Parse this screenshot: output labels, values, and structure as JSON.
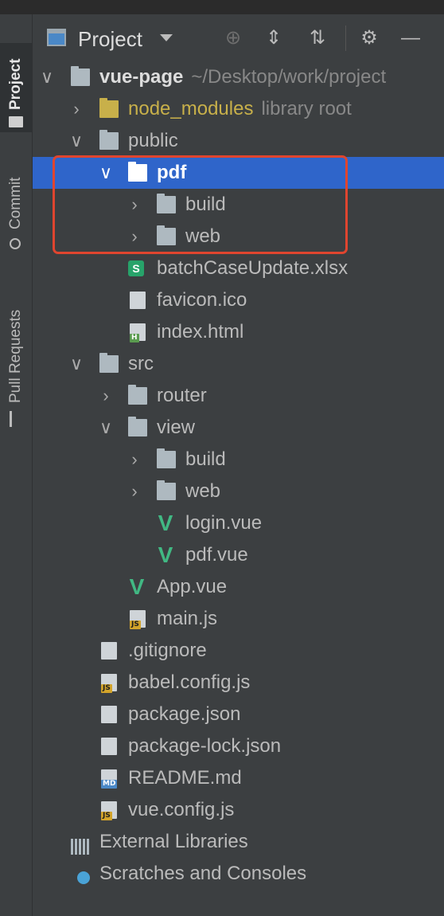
{
  "sidebar": {
    "tabs": [
      {
        "label": "Project"
      },
      {
        "label": "Commit"
      },
      {
        "label": "Pull Requests"
      }
    ]
  },
  "toolbar": {
    "title": "Project"
  },
  "tree": {
    "rows": [
      {
        "label": "vue-page",
        "hint": "~/Desktop/work/project"
      },
      {
        "label": "node_modules",
        "hint": "library root"
      },
      {
        "label": "public"
      },
      {
        "label": "pdf"
      },
      {
        "label": "build"
      },
      {
        "label": "web"
      },
      {
        "label": "batchCaseUpdate.xlsx"
      },
      {
        "label": "favicon.ico"
      },
      {
        "label": "index.html"
      },
      {
        "label": "src"
      },
      {
        "label": "router"
      },
      {
        "label": "view"
      },
      {
        "label": "build"
      },
      {
        "label": "web"
      },
      {
        "label": "login.vue"
      },
      {
        "label": "pdf.vue"
      },
      {
        "label": "App.vue"
      },
      {
        "label": "main.js"
      },
      {
        "label": ".gitignore"
      },
      {
        "label": "babel.config.js"
      },
      {
        "label": "package.json"
      },
      {
        "label": "package-lock.json"
      },
      {
        "label": "README.md"
      },
      {
        "label": "vue.config.js"
      },
      {
        "label": "External Libraries"
      },
      {
        "label": "Scratches and Consoles"
      }
    ]
  },
  "badges": {
    "js": "JS",
    "md": "MD",
    "html": "H",
    "sheet": "S"
  },
  "colors": {
    "selection": "#2f65ca",
    "highlight_box": "#e0452f",
    "library": "#c8b04a",
    "vue": "#41b883"
  }
}
